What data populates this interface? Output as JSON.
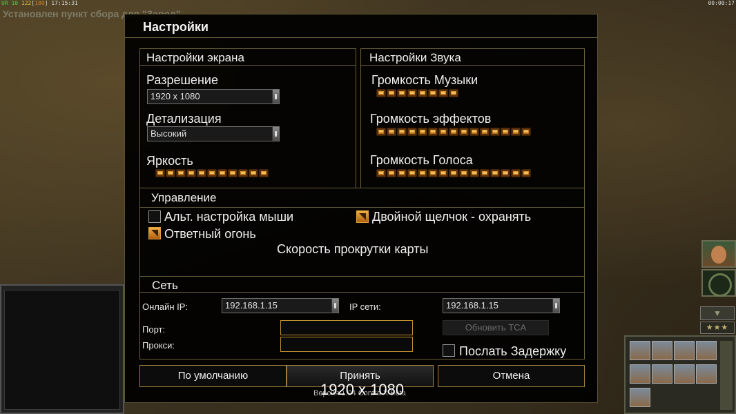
{
  "top_bar": {
    "stats_green": "UR 10",
    "stats_yellow": "122",
    "stats_orange": "180",
    "stats_time": "17:15:31",
    "game_time": "00:00:17"
  },
  "notice": "Установлен пункт сбора для \"Завод\"",
  "dialog": {
    "title": "Настройки",
    "screen": {
      "title": "Настройки экрана",
      "resolution_label": "Разрешение",
      "resolution_value": "1920 x 1080",
      "detail_label": "Детализация",
      "detail_value": "Высокий",
      "brightness_label": "Яркость",
      "brightness_level": "11/11"
    },
    "sound": {
      "title": "Настройки Звука",
      "music_label": "Громкость Музыки",
      "music_level": "8/15",
      "effects_label": "Громкость эффектов",
      "effects_level": "15/15",
      "voice_label": "Громкость Голоса",
      "voice_level": "15/15"
    },
    "controls": {
      "title": "Управление",
      "alt_mouse_label": "Альт. настройка мыши",
      "alt_mouse_checked": false,
      "double_click_label": "Двойной щелчок - охранять",
      "double_click_checked": true,
      "return_fire_label": "Ответный огонь",
      "return_fire_checked": true,
      "scroll_speed_label": "Скорость прокрутки карты"
    },
    "network": {
      "title": "Сеть",
      "online_ip_label": "Онлайн IP:",
      "online_ip_value": "192.168.1.15",
      "lan_ip_label": "IP сети:",
      "lan_ip_value": "192.168.1.15",
      "port_label": "Порт:",
      "proxy_label": "Прокси:",
      "update_tca_label": "Обновить TCA",
      "send_delay_label": "Послать Задержку",
      "send_delay_checked": false
    },
    "buttons": {
      "defaults": "По умолчанию",
      "accept": "Принять",
      "cancel": "Отмена"
    }
  },
  "overlay_resolution": "1920 x 1080",
  "version_text": "Версия 1.04 Contra X Beta",
  "hud": {
    "stars": "★★★",
    "down_arrow": "▼"
  },
  "colors": {
    "accent_gold": "#c09030",
    "frame_line": "#6a6238",
    "slider_orange": "#e8a030"
  }
}
